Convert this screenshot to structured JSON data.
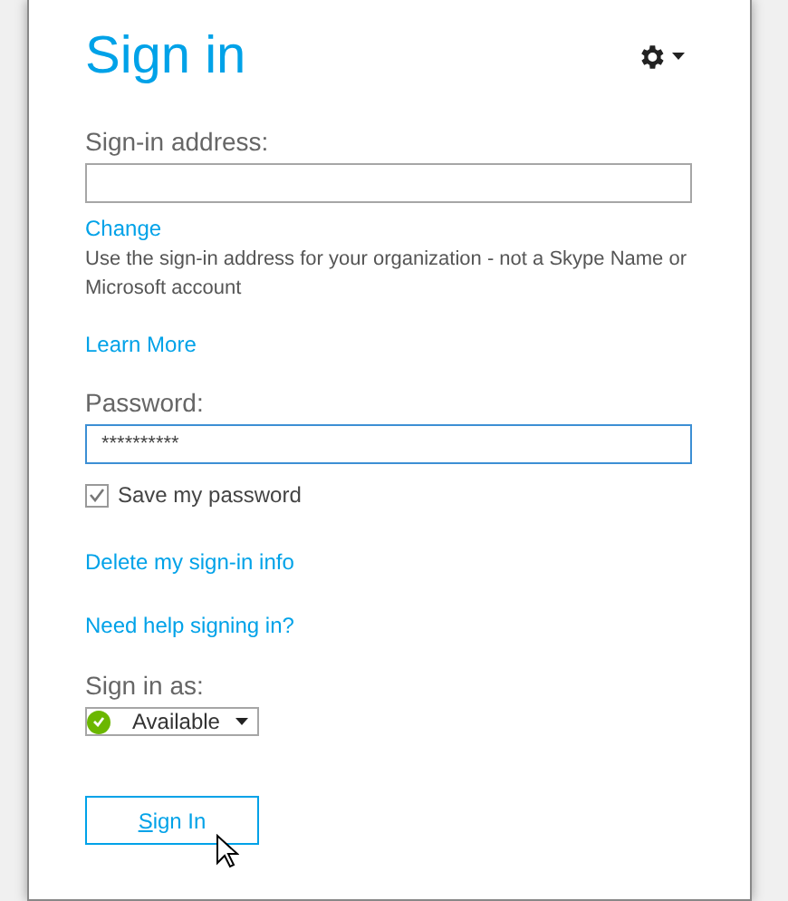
{
  "title": "Sign in",
  "address": {
    "label": "Sign-in address:"
  },
  "change_link": "Change",
  "help_text": "Use the sign-in address for your organization - not a Skype Name or Microsoft account",
  "learn_more_link": "Learn More",
  "password": {
    "label": "Password:",
    "value": "**********",
    "focused": true
  },
  "save_password": {
    "label": "Save my password",
    "checked": true
  },
  "delete_link": "Delete my sign-in info",
  "help_link": "Need help signing in?",
  "sign_in_as": {
    "label": "Sign in as:",
    "status": "Available",
    "color": "#6bb700"
  },
  "sign_in_button": "Sign In"
}
